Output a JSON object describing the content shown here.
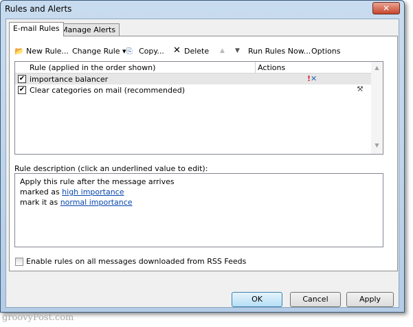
{
  "window": {
    "title": "Rules and Alerts",
    "close": "✕"
  },
  "tabs": [
    {
      "label": "E-mail Rules"
    },
    {
      "label": "Manage Alerts"
    }
  ],
  "toolbar": {
    "new_rule": "New Rule...",
    "change_rule": "Change Rule ▾",
    "copy": "Copy...",
    "delete": "Delete",
    "up": "▲",
    "down": "▼",
    "run_rules": "Run Rules Now...",
    "options": "Options"
  },
  "list": {
    "columns": [
      "Rule (applied in the order shown)",
      "Actions"
    ],
    "rows": [
      {
        "name": "importance balancer",
        "checked": true
      },
      {
        "name": "Clear categories on mail (recommended)",
        "checked": true
      }
    ]
  },
  "description": {
    "label": "Rule description (click an underlined value to edit):",
    "line1": "Apply this rule after the message arrives",
    "line2_prefix": "marked as ",
    "line2_link": "high importance",
    "line3_prefix": "mark it as ",
    "line3_link": "normal importance"
  },
  "rss": {
    "label": "Enable rules on all messages downloaded from RSS Feeds",
    "checked": false
  },
  "buttons": {
    "ok": "OK",
    "cancel": "Cancel",
    "apply": "Apply"
  },
  "watermark": "groovyPost.com"
}
